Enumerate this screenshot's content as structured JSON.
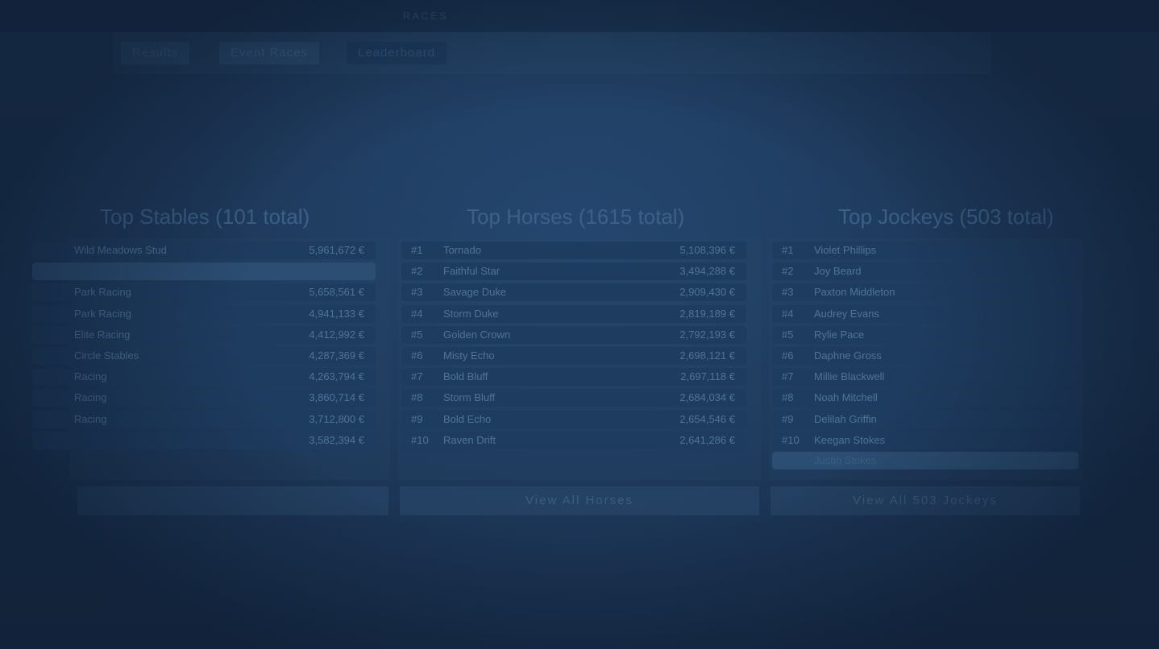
{
  "nav": {
    "items": [
      "",
      "",
      "Races",
      "",
      "",
      ""
    ]
  },
  "tabs": [
    {
      "label": "Results",
      "active": false
    },
    {
      "label": "Event Races",
      "active": false
    },
    {
      "label": "Leaderboard",
      "active": true
    }
  ],
  "stables": {
    "title": "Top Stables (101 total)",
    "rows": [
      {
        "rank": "",
        "name": "Wild Meadows Stud",
        "value": "5,961,672 €"
      },
      {
        "rank": "",
        "name": "",
        "value": ""
      },
      {
        "rank": "",
        "name": "Park Racing",
        "value": "5,658,561 €"
      },
      {
        "rank": "",
        "name": "Park Racing",
        "value": "4,941,133 €"
      },
      {
        "rank": "",
        "name": "Elite Racing",
        "value": "4,412,992 €"
      },
      {
        "rank": "",
        "name": "Circle Stables",
        "value": "4,287,369 €"
      },
      {
        "rank": "",
        "name": "Racing",
        "value": "4,263,794 €"
      },
      {
        "rank": "",
        "name": "Racing",
        "value": "3,860,714 €"
      },
      {
        "rank": "",
        "name": "Racing",
        "value": "3,712,800 €"
      },
      {
        "rank": "",
        "name": "",
        "value": "3,582,394 €"
      }
    ],
    "button": ""
  },
  "horses": {
    "title": "Top Horses (1615 total)",
    "rows": [
      {
        "rank": "#1",
        "name": "Tornado",
        "value": "5,108,396 €"
      },
      {
        "rank": "#2",
        "name": "Faithful Star",
        "value": "3,494,288 €"
      },
      {
        "rank": "#3",
        "name": "Savage Duke",
        "value": "2,909,430 €"
      },
      {
        "rank": "#4",
        "name": "Storm Duke",
        "value": "2,819,189 €"
      },
      {
        "rank": "#5",
        "name": "Golden Crown",
        "value": "2,792,193 €"
      },
      {
        "rank": "#6",
        "name": "Misty Echo",
        "value": "2,698,121 €"
      },
      {
        "rank": "#7",
        "name": "Bold Bluff",
        "value": "2,697,118 €"
      },
      {
        "rank": "#8",
        "name": "Storm Bluff",
        "value": "2,684,034 €"
      },
      {
        "rank": "#9",
        "name": "Bold Echo",
        "value": "2,654,546 €"
      },
      {
        "rank": "#10",
        "name": "Raven Drift",
        "value": "2,641,286 €"
      }
    ],
    "button": "View All Horses"
  },
  "jockeys": {
    "title": "Top Jockeys (503 total)",
    "rows": [
      {
        "rank": "#1",
        "name": "Violet Phillips",
        "value": ""
      },
      {
        "rank": "#2",
        "name": "Joy Beard",
        "value": ""
      },
      {
        "rank": "#3",
        "name": "Paxton Middleton",
        "value": ""
      },
      {
        "rank": "#4",
        "name": "Audrey Evans",
        "value": ""
      },
      {
        "rank": "#5",
        "name": "Rylie Pace",
        "value": ""
      },
      {
        "rank": "#6",
        "name": "Daphne Gross",
        "value": ""
      },
      {
        "rank": "#7",
        "name": "Millie Blackwell",
        "value": ""
      },
      {
        "rank": "#8",
        "name": "Noah Mitchell",
        "value": ""
      },
      {
        "rank": "#9",
        "name": "Delilah Griffin",
        "value": ""
      },
      {
        "rank": "#10",
        "name": "Keegan Stokes",
        "value": ""
      }
    ],
    "extra_row": {
      "name": "Justin Stokes"
    },
    "button": "View All 503 Jockeys"
  }
}
